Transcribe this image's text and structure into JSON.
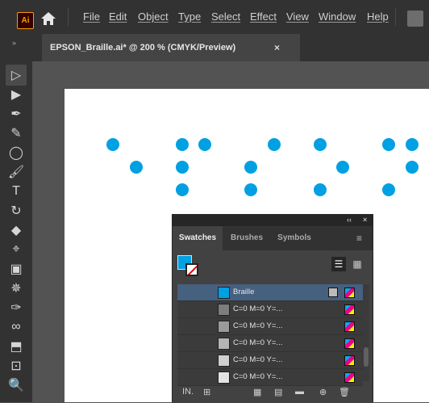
{
  "app": {
    "logo_text": "Ai"
  },
  "menu": {
    "items": [
      "File",
      "Edit",
      "Object",
      "Type",
      "Select",
      "Effect",
      "View",
      "Window",
      "Help"
    ]
  },
  "document": {
    "tab_title": "EPSON_Braille.ai* @ 200 % (CMYK/Preview)",
    "close_glyph": "×"
  },
  "toolbar": {
    "collapse_glyph": "»",
    "tools": [
      {
        "name": "selection-tool",
        "glyph": "▷"
      },
      {
        "name": "direct-selection-tool",
        "glyph": "▶"
      },
      {
        "name": "pen-tool",
        "glyph": "✒"
      },
      {
        "name": "curvature-tool",
        "glyph": "✎"
      },
      {
        "name": "ellipse-tool",
        "glyph": "◯"
      },
      {
        "name": "paintbrush-tool",
        "glyph": "🖌"
      },
      {
        "name": "type-tool",
        "glyph": "T"
      },
      {
        "name": "rotate-tool",
        "glyph": "↻"
      },
      {
        "name": "eraser-tool",
        "glyph": "◆"
      },
      {
        "name": "width-tool",
        "glyph": "⌖"
      },
      {
        "name": "gradient-tool",
        "glyph": "▣"
      },
      {
        "name": "symbol-sprayer-tool",
        "glyph": "✵"
      },
      {
        "name": "eyedropper-tool",
        "glyph": "✑"
      },
      {
        "name": "blend-tool",
        "glyph": "∞"
      },
      {
        "name": "shape-builder-tool",
        "glyph": "⬒"
      },
      {
        "name": "artboard-tool",
        "glyph": "⊡"
      },
      {
        "name": "zoom-tool",
        "glyph": "🔍"
      }
    ]
  },
  "canvas": {
    "dot_color": "#00a0e3"
  },
  "swatches_panel": {
    "panel_controls": {
      "collapse": "‹‹",
      "close": "×"
    },
    "tabs": [
      "Swatches",
      "Brushes",
      "Symbols"
    ],
    "menu_glyph": "≡",
    "view_list_glyph": "☰",
    "view_grid_glyph": "▦",
    "rows": [
      {
        "label": "Braille",
        "color": "#00a0e3",
        "selected": true,
        "spot": true
      },
      {
        "label": "C=0 M=0 Y=...",
        "color": "#7d7d7d",
        "selected": false,
        "spot": false
      },
      {
        "label": "C=0 M=0 Y=...",
        "color": "#9a9a9a",
        "selected": false,
        "spot": false
      },
      {
        "label": "C=0 M=0 Y=...",
        "color": "#b4b4b4",
        "selected": false,
        "spot": false
      },
      {
        "label": "C=0 M=0 Y=...",
        "color": "#cfcfcf",
        "selected": false,
        "spot": false
      },
      {
        "label": "C=0 M=0 Y=...",
        "color": "#e3e3e3",
        "selected": false,
        "spot": false
      }
    ],
    "footer_icons": [
      {
        "name": "swatch-libraries-icon",
        "glyph": "IN."
      },
      {
        "name": "place-swatches-icon",
        "glyph": "⊞"
      },
      {
        "name": "show-kinds-icon",
        "glyph": "▦"
      },
      {
        "name": "swatch-options-icon",
        "glyph": "▤"
      },
      {
        "name": "new-group-icon",
        "glyph": "▬"
      },
      {
        "name": "new-swatch-icon",
        "glyph": "⊕"
      },
      {
        "name": "delete-swatch-icon",
        "glyph": "🗑"
      }
    ]
  }
}
